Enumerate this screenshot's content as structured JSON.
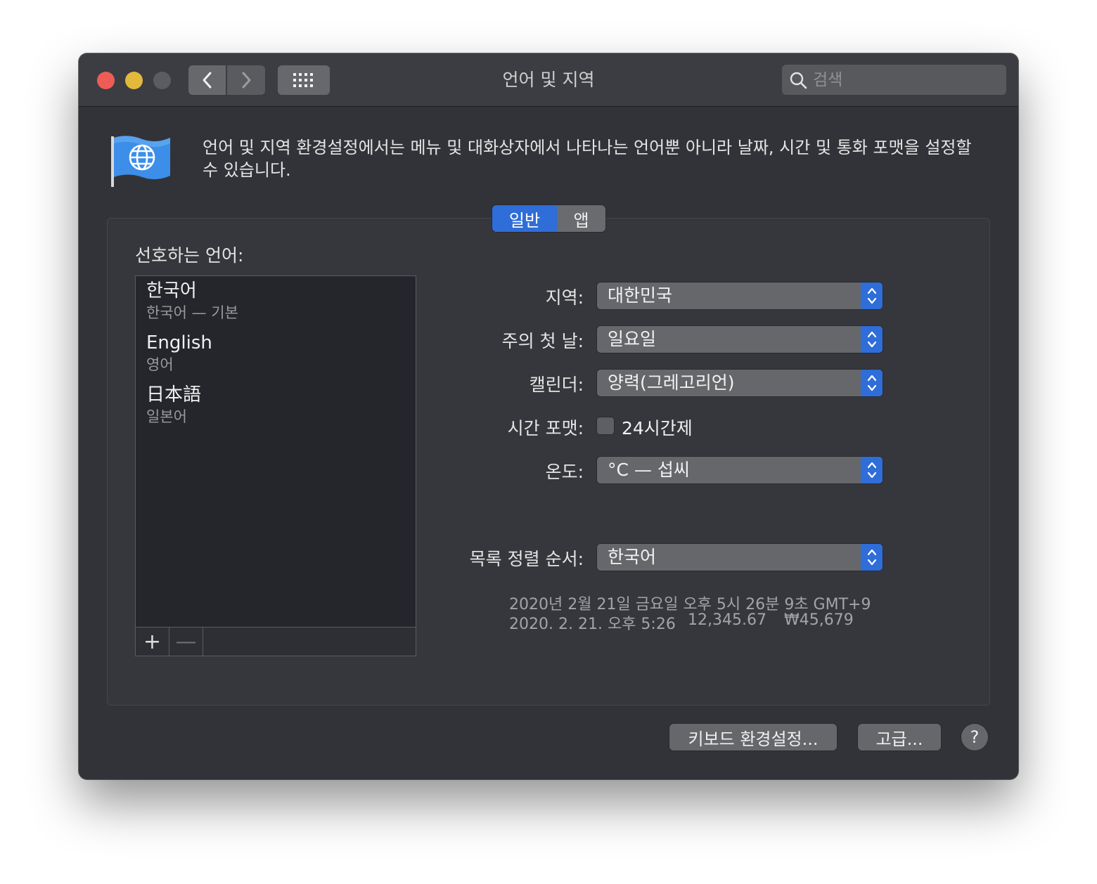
{
  "window": {
    "title": "언어 및 지역",
    "search_placeholder": "검색"
  },
  "description": "언어 및 지역 환경설정에서는 메뉴 및 대화상자에서 나타나는 언어뿐 아니라 날짜, 시간 및 통화 포맷을 설정할 수 있습니다.",
  "tabs": [
    {
      "label": "일반",
      "active": true
    },
    {
      "label": "앱",
      "active": false
    }
  ],
  "languages": {
    "label": "선호하는 언어:",
    "items": [
      {
        "name": "한국어",
        "sub": "한국어 — 기본"
      },
      {
        "name": "English",
        "sub": "영어"
      },
      {
        "name": "日本語",
        "sub": "일본어"
      }
    ],
    "add_glyph": "+",
    "remove_glyph": "—"
  },
  "settings": {
    "region": {
      "label": "지역:",
      "value": "대한민국"
    },
    "first_day": {
      "label": "주의 첫 날:",
      "value": "일요일"
    },
    "calendar": {
      "label": "캘린더:",
      "value": "양력(그레고리언)"
    },
    "time_format": {
      "label": "시간 포맷:",
      "checkbox_label": "24시간제",
      "checked": false
    },
    "temperature": {
      "label": "온도:",
      "value": "°C — 섭씨"
    },
    "sort_order": {
      "label": "목록 정렬 순서:",
      "value": "한국어"
    }
  },
  "sample": {
    "long_date": "2020년 2월 21일 금요일 오후 5시 26분 9초 GMT+9",
    "short_date": "2020. 2. 21. 오후 5:26",
    "number": "12,345.67",
    "currency": "₩45,679"
  },
  "buttons": {
    "keyboard": "키보드 환경설정...",
    "advanced": "고급...",
    "help": "?"
  },
  "colors": {
    "accent": "#2f6dd8",
    "close": "#ed5d55",
    "minimize": "#e3b93c",
    "window_bg": "#323338"
  }
}
